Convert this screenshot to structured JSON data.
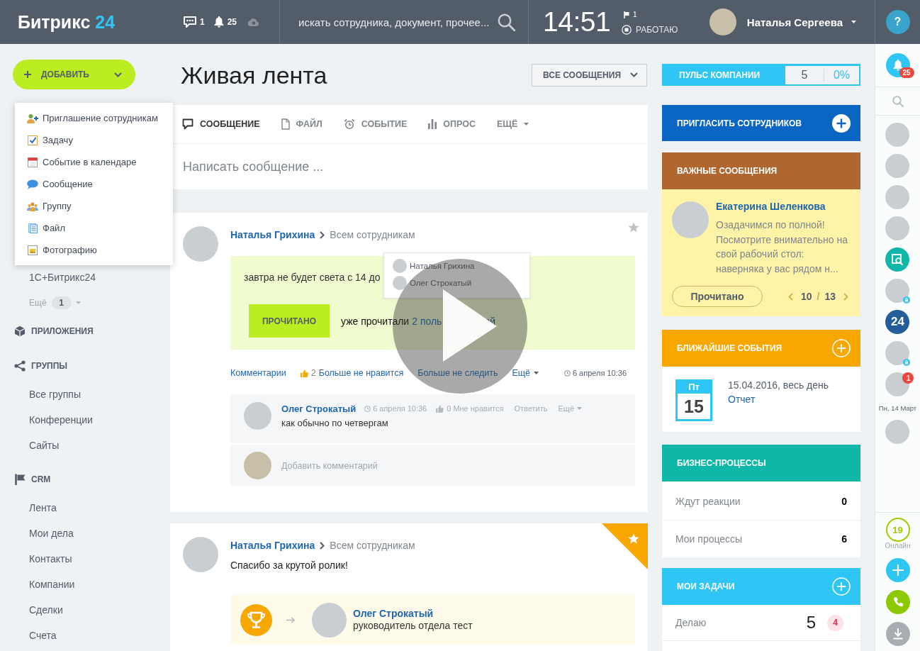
{
  "header": {
    "logo": {
      "name": "Битрикс",
      "number": "24"
    },
    "counters": [
      {
        "kind": "chat",
        "count": "1"
      },
      {
        "kind": "bell",
        "count": "25"
      },
      {
        "kind": "cloud"
      }
    ],
    "search": {
      "placeholder": "искать сотрудника, документ, прочее..."
    },
    "clock": {
      "time": "14:51",
      "flag_count": "1",
      "status": "РАБОТАЮ"
    },
    "user": {
      "name": "Наталья Сергеева"
    },
    "help": "?"
  },
  "add_button": {
    "label": "ДОБАВИТЬ",
    "expanded": true
  },
  "add_menu": [
    {
      "kind": "invite",
      "label": "Приглашение сотрудникам"
    },
    {
      "kind": "task",
      "label": "Задачу"
    },
    {
      "kind": "event",
      "label": "Событие в календаре"
    },
    {
      "kind": "message",
      "label": "Сообщение"
    },
    {
      "kind": "group",
      "label": "Группу"
    },
    {
      "kind": "file",
      "label": "Файл"
    },
    {
      "kind": "photo",
      "label": "Фотографию"
    }
  ],
  "sidebar": {
    "links": [
      "1С+Битрикс24"
    ],
    "more": {
      "label": "Ещё",
      "count": "1"
    },
    "apps": {
      "label": "ПРИЛОЖЕНИЯ"
    },
    "groups": {
      "label": "ГРУППЫ",
      "items": [
        "Все группы",
        "Конференции",
        "Сайты"
      ]
    },
    "crm": {
      "label": "CRM",
      "items": [
        "Лента",
        "Мои дела",
        "Контакты",
        "Компании",
        "Сделки",
        "Счета"
      ]
    }
  },
  "feed": {
    "title": "Живая лента",
    "filter": "ВСЕ СООБЩЕНИЯ",
    "composer": {
      "tabs": [
        {
          "kind": "message",
          "label": "СООБЩЕНИЕ",
          "selected": true
        },
        {
          "kind": "file",
          "label": "ФАЙЛ",
          "selected": false
        },
        {
          "kind": "event",
          "label": "СОБЫТИЕ",
          "selected": false
        },
        {
          "kind": "poll",
          "label": "ОПРОС",
          "selected": false
        },
        {
          "kind": "more",
          "label": "ЕЩЁ",
          "selected": false
        }
      ],
      "placeholder": "Написать сообщение ..."
    },
    "posts": [
      {
        "kind": "important",
        "author": "Наталья Грихина",
        "audience": "Всем сотрудникам",
        "favorite": false,
        "text": "завтра не будет света с 14 до",
        "button": "ПРОЧИТАНО",
        "read_prefix": "уже прочитали",
        "read_link": "2 поль",
        "read_link_tail": "ей",
        "readers": [
          "Наталья Грихина",
          "Олег Строкатый"
        ],
        "actions": {
          "comments": "Комментарии",
          "like_count": "2",
          "like": "Больше не нравится",
          "liked": true,
          "follow": "Больше не следить",
          "more": "Ещё",
          "time": "6 апреля 10:36"
        },
        "comments": [
          {
            "author": "Олег Строкатый",
            "time": "6 апреля 10:36",
            "like_count": "0",
            "like": "Мне нравится",
            "liked": false,
            "reply": "Ответить",
            "more": "Ещё",
            "text": "как обычно по четвергам"
          }
        ],
        "add_comment": {
          "placeholder": "Добавить комментарий"
        }
      },
      {
        "kind": "grant",
        "author": "Наталья Грихина",
        "audience": "Всем сотрудникам",
        "favorite": true,
        "text": "Спасибо за крутой ролик!",
        "grant": {
          "recipient": "Олег Строкатый",
          "position": "руководитель отдела тест"
        }
      }
    ]
  },
  "play_overlay": true,
  "widgets": {
    "pulse": {
      "label": "ПУЛЬС КОМПАНИИ",
      "value": "5",
      "percent": "0%"
    },
    "invite": {
      "label": "ПРИГЛАСИТЬ СОТРУДНИКОВ"
    },
    "important": {
      "title": "ВАЖНЫЕ СООБЩЕНИЯ",
      "author": "Екатерина Шеленкова",
      "text": "Озадачимся по полной! Посмотрите внимательно на свой рабочий стол: наверняка у вас рядом н...",
      "button": "Прочитано",
      "pager": {
        "current": "10",
        "separator": "/",
        "total": "13"
      }
    },
    "events": {
      "title": "БЛИЖАЙШИЕ СОБЫТИЯ",
      "items": [
        {
          "weekday": "Пт",
          "day": "15",
          "when": "15.04.2016, весь день",
          "name": "Отчет"
        }
      ]
    },
    "processes": {
      "title": "БИЗНЕС-ПРОЦЕССЫ",
      "rows": [
        {
          "label": "Ждут реакции",
          "value": "0"
        },
        {
          "label": "Мои процессы",
          "value": "6"
        }
      ]
    },
    "tasks": {
      "title": "МОИ ЗАДАЧИ",
      "rows": [
        {
          "label": "Делаю",
          "value": "5",
          "badge": "4"
        }
      ]
    }
  },
  "rail": {
    "notifications": "25",
    "items": [
      {
        "kind": "user",
        "locked": false
      },
      {
        "kind": "user",
        "locked": false
      },
      {
        "kind": "user",
        "locked": false
      },
      {
        "kind": "user",
        "locked": false
      },
      {
        "kind": "service"
      },
      {
        "kind": "user",
        "locked": true
      },
      {
        "kind": "logo",
        "label": "24"
      },
      {
        "kind": "user",
        "locked": true
      },
      {
        "kind": "user",
        "locked": false,
        "unread": "1"
      },
      {
        "kind": "date",
        "label": "Пн, 14 Март"
      },
      {
        "kind": "user",
        "locked": false
      }
    ],
    "online": {
      "count": "19",
      "label": "Онлайн"
    }
  }
}
